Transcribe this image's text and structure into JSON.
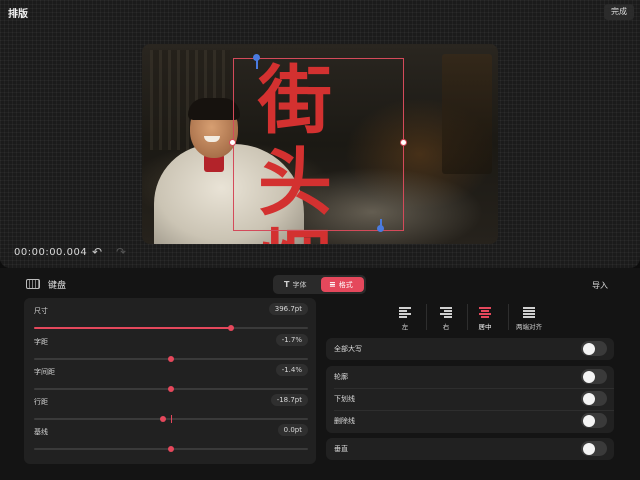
{
  "header": {
    "title": "排版",
    "done_label": "完成"
  },
  "canvas": {
    "headline_text": "街头\n烟火",
    "headline_color": "#d33130",
    "selection_color": "#d44a5a",
    "handle_color": "#4a7be0"
  },
  "playback": {
    "timecode": "00:00:00.004",
    "undo_icon": "undo-icon",
    "redo_icon": "redo-icon"
  },
  "toolbar": {
    "keyboard_label": "键盘",
    "tabs": [
      {
        "glyph": "T",
        "label": "字体",
        "active": false
      },
      {
        "glyph": "≡",
        "label": "格式",
        "active": true
      }
    ],
    "import_label": "导入"
  },
  "sliders": [
    {
      "label": "尺寸",
      "value": "396.7pt",
      "fraction": 0.72
    },
    {
      "label": "字距",
      "value": "-1.7%",
      "fraction": 0.5
    },
    {
      "label": "字间距",
      "value": "-1.4%",
      "fraction": 0.5
    },
    {
      "label": "行距",
      "value": "-18.7pt",
      "fraction": 0.47
    },
    {
      "label": "基线",
      "value": "0.0pt",
      "fraction": 0.5
    }
  ],
  "alignment": {
    "options": [
      {
        "label": "左",
        "active": false
      },
      {
        "label": "右",
        "active": false
      },
      {
        "label": "居中",
        "active": true
      },
      {
        "label": "两端对齐",
        "active": false
      }
    ]
  },
  "toggles": {
    "all_caps": {
      "label": "全部大写",
      "on": false
    },
    "outline": {
      "label": "轮廓",
      "on": false
    },
    "underline": {
      "label": "下划线",
      "on": false
    },
    "strikethrough": {
      "label": "删除线",
      "on": false
    },
    "vertical": {
      "label": "垂直",
      "on": false
    }
  },
  "colors": {
    "accent": "#e5485c",
    "panel": "#212121",
    "background": "#141414"
  }
}
